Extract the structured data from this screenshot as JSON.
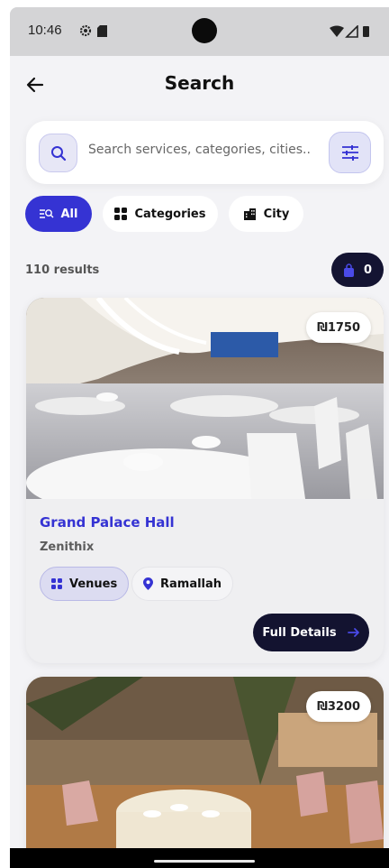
{
  "status_bar": {
    "time": "10:46"
  },
  "header": {
    "title": "Search"
  },
  "search": {
    "placeholder": "Search services, categories, cities.."
  },
  "filters": [
    {
      "label": "All",
      "active": true
    },
    {
      "label": "Categories",
      "active": false
    },
    {
      "label": "City",
      "active": false
    }
  ],
  "results": {
    "count_label": "110 results",
    "cart_count": "0"
  },
  "listings": [
    {
      "price": "₪1750",
      "name": "Grand Palace Hall",
      "provider": "Zenithix",
      "category": "Venues",
      "city": "Ramallah",
      "details_label": "Full Details"
    },
    {
      "price": "₪3200"
    }
  ],
  "colors": {
    "accent": "#3533d3",
    "dark_button": "#131330",
    "background": "#f3f3f6"
  }
}
